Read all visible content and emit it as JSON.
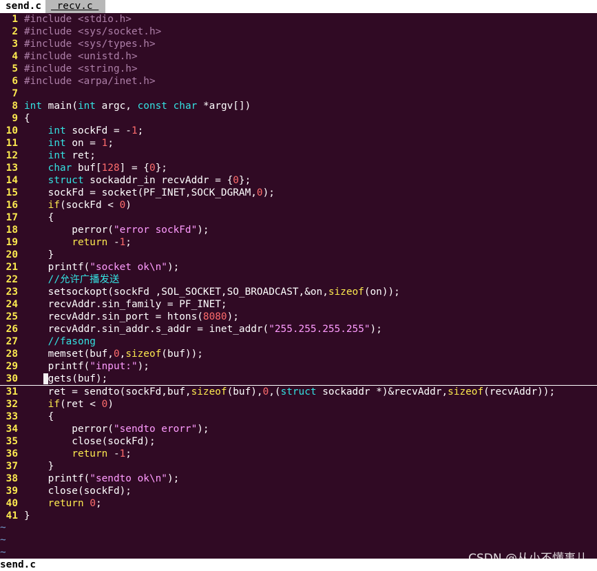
{
  "tabs": [
    {
      "label": "send.c",
      "active": true
    },
    {
      "label": " recv.c ",
      "active": false
    }
  ],
  "lines": [
    {
      "n": "1",
      "text": "#include <stdio.h>"
    },
    {
      "n": "2",
      "text": "#include <sys/socket.h>"
    },
    {
      "n": "3",
      "text": "#include <sys/types.h>"
    },
    {
      "n": "4",
      "text": "#include <unistd.h>"
    },
    {
      "n": "5",
      "text": "#include <string.h>"
    },
    {
      "n": "6",
      "text": "#include <arpa/inet.h>"
    },
    {
      "n": "7",
      "text": ""
    },
    {
      "n": "8",
      "text": "int main(int argc, const char *argv[])"
    },
    {
      "n": "9",
      "text": "{"
    },
    {
      "n": "10",
      "text": "    int sockFd = -1;"
    },
    {
      "n": "11",
      "text": "    int on = 1;"
    },
    {
      "n": "12",
      "text": "    int ret;"
    },
    {
      "n": "13",
      "text": "    char buf[128] = {0};"
    },
    {
      "n": "14",
      "text": "    struct sockaddr_in recvAddr = {0};"
    },
    {
      "n": "15",
      "text": "    sockFd = socket(PF_INET,SOCK_DGRAM,0);"
    },
    {
      "n": "16",
      "text": "    if(sockFd < 0)"
    },
    {
      "n": "17",
      "text": "    {"
    },
    {
      "n": "18",
      "text": "        perror(\"error sockFd\");"
    },
    {
      "n": "19",
      "text": "        return -1;"
    },
    {
      "n": "20",
      "text": "    }"
    },
    {
      "n": "21",
      "text": "    printf(\"socket ok\\n\");"
    },
    {
      "n": "22",
      "text": "    //允许广播发送"
    },
    {
      "n": "23",
      "text": "    setsockopt(sockFd ,SOL_SOCKET,SO_BROADCAST,&on,sizeof(on));"
    },
    {
      "n": "24",
      "text": "    recvAddr.sin_family = PF_INET;"
    },
    {
      "n": "25",
      "text": "    recvAddr.sin_port = htons(8080);"
    },
    {
      "n": "26",
      "text": "    recvAddr.sin_addr.s_addr = inet_addr(\"255.255.255.255\");"
    },
    {
      "n": "27",
      "text": "    //fasong"
    },
    {
      "n": "28",
      "text": "    memset(buf,0,sizeof(buf));"
    },
    {
      "n": "29",
      "text": "    printf(\"input:\");"
    },
    {
      "n": "30",
      "text": "    gets(buf);",
      "cursor": true
    },
    {
      "n": "31",
      "text": "    ret = sendto(sockFd,buf,sizeof(buf),0,(struct sockaddr *)&recvAddr,sizeof(recvAddr));"
    },
    {
      "n": "32",
      "text": "    if(ret < 0)"
    },
    {
      "n": "33",
      "text": "    {"
    },
    {
      "n": "34",
      "text": "        perror(\"sendto erorr\");"
    },
    {
      "n": "35",
      "text": "        close(sockFd);"
    },
    {
      "n": "36",
      "text": "        return -1;"
    },
    {
      "n": "37",
      "text": "    }"
    },
    {
      "n": "38",
      "text": "    printf(\"sendto ok\\n\");"
    },
    {
      "n": "39",
      "text": "    close(sockFd);"
    },
    {
      "n": "40",
      "text": "    return 0;"
    },
    {
      "n": "41",
      "text": "}"
    }
  ],
  "empty_line_markers": [
    "~",
    "~",
    "~"
  ],
  "status": {
    "filename": "send.c"
  },
  "watermark": "CSDN @从小不懂事儿",
  "colors": {
    "background": "#300a24",
    "line_number": "#fce94f",
    "type": "#34e2e2",
    "keyword": "#fce94f",
    "preprocessor": "#ad7fa8",
    "number": "#ff6d6d",
    "string": "#ff9cff",
    "tilde": "#729fcf"
  }
}
